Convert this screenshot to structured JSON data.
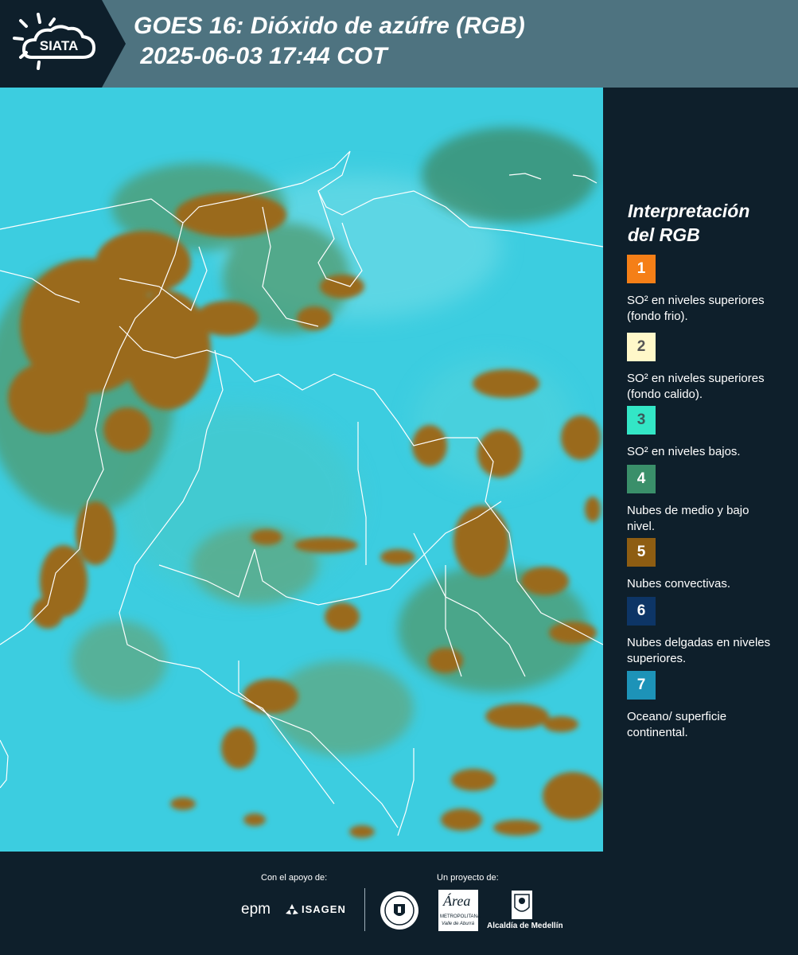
{
  "header": {
    "logo_text": "SIATA",
    "title_line1": "GOES 16: Dióxido de azúfre (RGB)",
    "title_line2": " 2025-06-03 17:44 COT"
  },
  "legend": {
    "title_line1": "Interpretación",
    "title_line2": "del RGB",
    "items": [
      {
        "number": "1",
        "label": "SO² en niveles superiores (fondo frio).",
        "color": "#f57f17",
        "text_color": "#ffffff"
      },
      {
        "number": "2",
        "label": "SO² en niveles superiores (fondo calido).",
        "color": "#fff8c9",
        "text_color": "#555555"
      },
      {
        "number": "3",
        "label": "SO² en niveles bajos.",
        "color": "#33e6c6",
        "text_color": "#3a5a5a"
      },
      {
        "number": "4",
        "label": "Nubes de medio y bajo nivel.",
        "color": "#3a8f6a",
        "text_color": "#ffffff"
      },
      {
        "number": "5",
        "label": "Nubes convectivas.",
        "color": "#8e5d12",
        "text_color": "#ffffff"
      },
      {
        "number": "6",
        "label": "Nubes delgadas en niveles superiores.",
        "color": "#0d3566",
        "text_color": "#ffffff"
      },
      {
        "number": "7",
        "label": "Oceano/ superficie continental.",
        "color": "#1d93b8",
        "text_color": "#ffffff"
      }
    ]
  },
  "footer": {
    "support_label": "Con el apoyo de:",
    "project_label": "Un proyecto de:",
    "epm": "epm",
    "isagen": "ISAGEN",
    "area_name": "Área",
    "area_sub1": "METROPOLITANA",
    "area_sub2": "Valle de Aburrá",
    "alcaldia": "Alcaldía de Medellín"
  },
  "colors": {
    "header_bg": "#4e7380",
    "logo_bg": "#0e1f2b",
    "page_bg": "#0e1f2b",
    "ocean": "#3ccde0",
    "convective": "#9a6b1c",
    "mid_low": "#4f9a6e"
  }
}
